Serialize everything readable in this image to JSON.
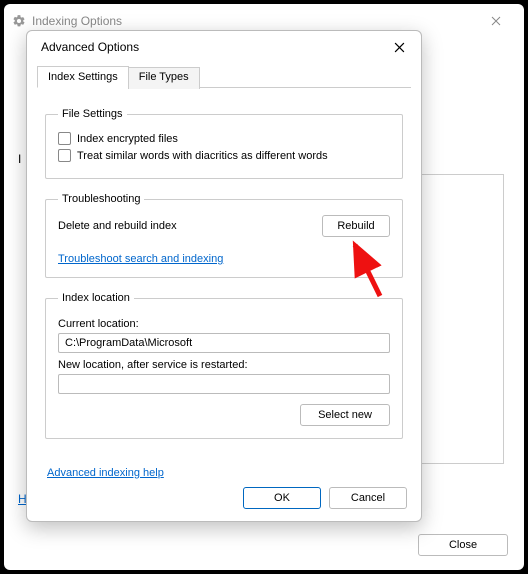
{
  "outer": {
    "title": "Indexing Options",
    "left_letter": "I",
    "left_link": "H",
    "close_label": "Close"
  },
  "inner": {
    "title": "Advanced Options",
    "tabs": {
      "settings": "Index Settings",
      "filetypes": "File Types"
    },
    "file_settings": {
      "legend": "File Settings",
      "encrypted": "Index encrypted files",
      "diacritics": "Treat similar words with diacritics as different words"
    },
    "troubleshooting": {
      "legend": "Troubleshooting",
      "delete_rebuild": "Delete and rebuild index",
      "rebuild_btn": "Rebuild",
      "ts_link": "Troubleshoot search and indexing"
    },
    "location": {
      "legend": "Index location",
      "current_label": "Current location:",
      "current_value": "C:\\ProgramData\\Microsoft",
      "new_label": "New location, after service is restarted:",
      "new_value": "",
      "select_new": "Select new"
    },
    "help_link": "Advanced indexing help",
    "ok": "OK",
    "cancel": "Cancel"
  }
}
